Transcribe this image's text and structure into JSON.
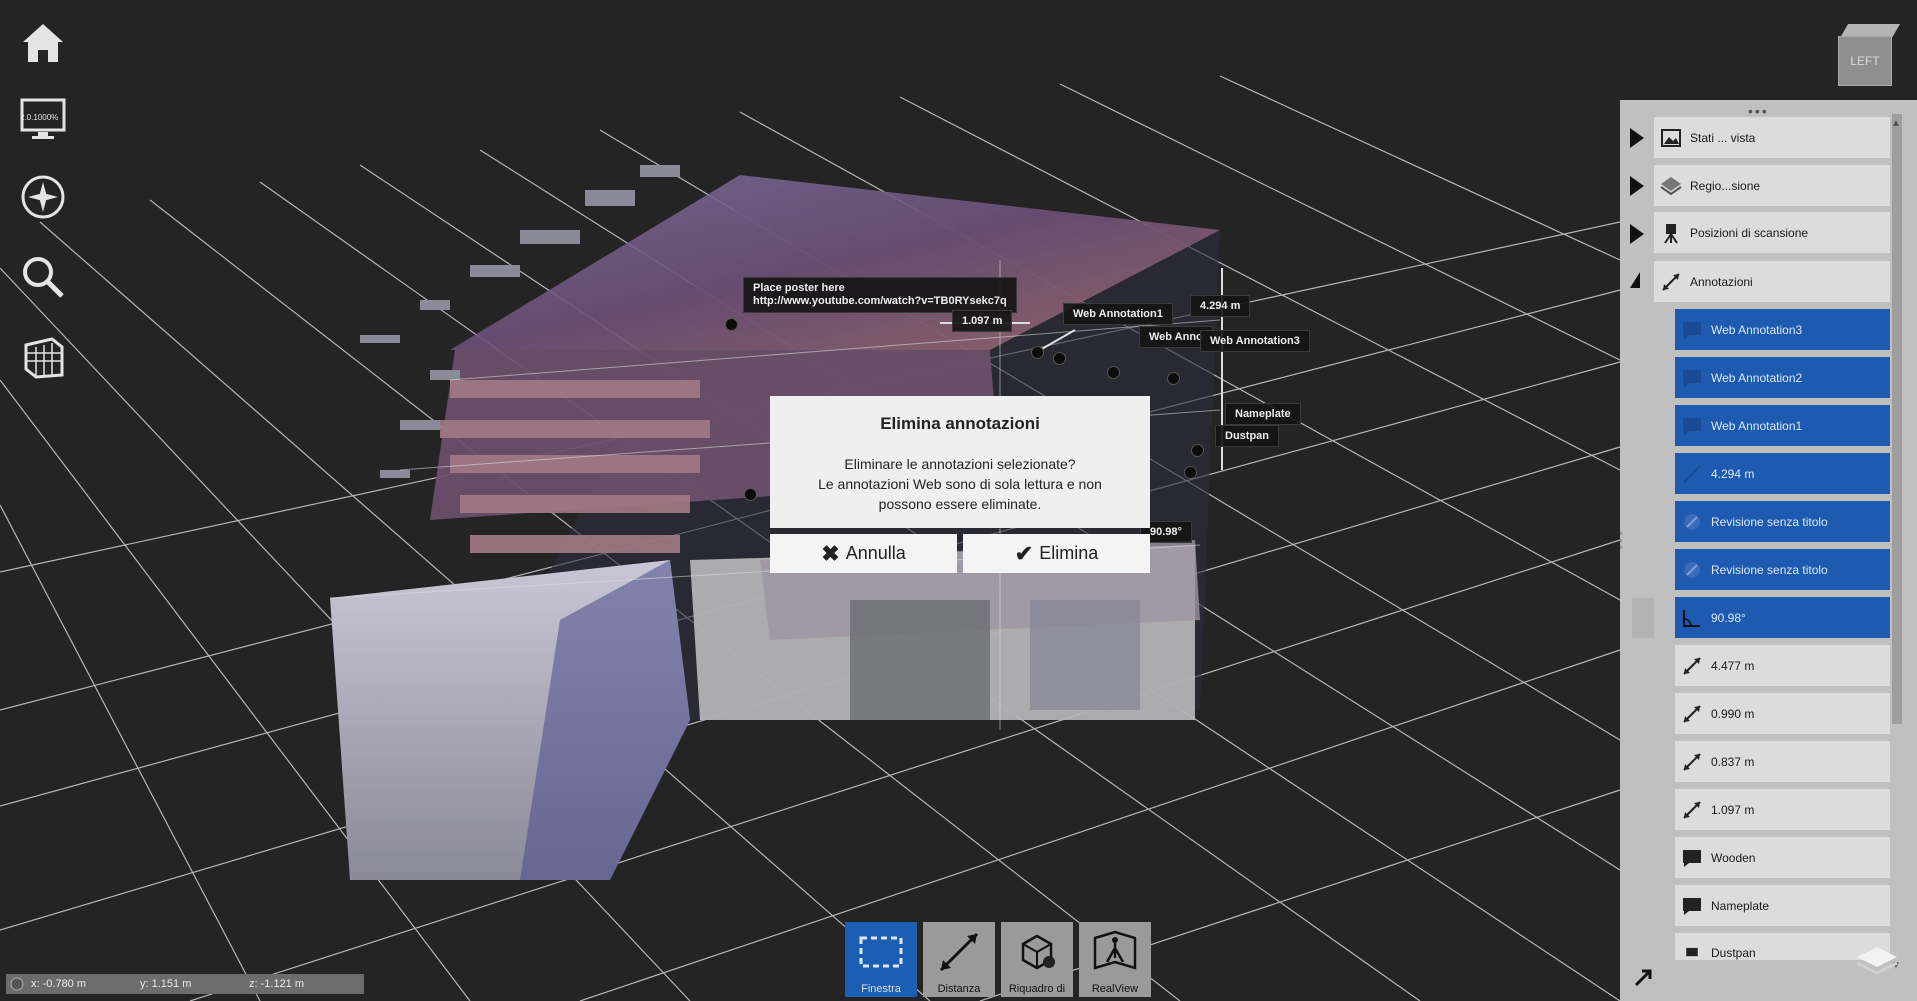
{
  "left_toolbar": [
    {
      "id": "home",
      "icon": "home-icon"
    },
    {
      "id": "display",
      "icon": "monitor-icon",
      "caption": "2.0.1000%"
    },
    {
      "id": "navigation",
      "icon": "compass-icon"
    },
    {
      "id": "zoom",
      "icon": "magnifier-icon"
    },
    {
      "id": "clip",
      "icon": "clipping-box-icon"
    }
  ],
  "viewcube": {
    "face_label": "LEFT"
  },
  "scene_labels": {
    "poster_line1": "Place poster here",
    "poster_line2": "http://www.youtube.com/watch?v=TB0RYsekc7q",
    "dist_1097": "1.097 m",
    "web1": "Web Annotation1",
    "dist_4294": "4.294 m",
    "web2": "Web Anno",
    "web3": "Web Annotation3",
    "nameplate": "Nameplate",
    "dustpan": "Dustpan",
    "angle": "90.98°"
  },
  "dialog": {
    "title": "Elimina annotazioni",
    "message_line1": "Eliminare le annotazioni selezionate?",
    "message_line2": "Le annotazioni Web sono di sola lettura e non",
    "message_line3": "possono essere eliminate.",
    "cancel_label": "Annulla",
    "confirm_label": "Elimina"
  },
  "bottom_toolbar": {
    "finestra": "Finestra",
    "distanza": "Distanza",
    "riquadro": "Riquadro di",
    "realview": "RealView"
  },
  "statusbar": {
    "x": "x:  -0.780 m",
    "y": "y:  1.151 m",
    "z": "z:  -1.121 m"
  },
  "tree": {
    "groups": [
      {
        "label": "Stati ... vista",
        "icon": "image-icon"
      },
      {
        "label": "Regio...sione",
        "icon": "layers-icon"
      },
      {
        "label": "Posizioni di scansione",
        "icon": "scanner-icon"
      },
      {
        "label": "Annotazioni",
        "icon": "measure-icon"
      }
    ],
    "items": [
      {
        "label": "Web Annotation3",
        "icon": "comment-icon",
        "selected": true
      },
      {
        "label": "Web Annotation2",
        "icon": "comment-icon",
        "selected": true
      },
      {
        "label": "Web Annotation1",
        "icon": "comment-icon",
        "selected": true
      },
      {
        "label": "4.294 m",
        "icon": "measure-icon",
        "selected": true
      },
      {
        "label": "Revisione senza titolo",
        "icon": "markup-icon",
        "selected": true
      },
      {
        "label": "Revisione senza titolo",
        "icon": "markup-icon",
        "selected": true
      },
      {
        "label": "90.98°",
        "icon": "angle-icon",
        "selected": true
      },
      {
        "label": "4.477 m",
        "icon": "measure-icon",
        "selected": false
      },
      {
        "label": "0.990 m",
        "icon": "measure-icon",
        "selected": false
      },
      {
        "label": "0.837 m",
        "icon": "measure-icon",
        "selected": false
      },
      {
        "label": "1.097 m",
        "icon": "measure-icon",
        "selected": false
      },
      {
        "label": "Wooden",
        "icon": "comment-icon",
        "selected": false
      },
      {
        "label": "Nameplate",
        "icon": "comment-icon",
        "selected": false
      },
      {
        "label": "Dustpan",
        "icon": "comment-icon",
        "selected": false
      }
    ]
  },
  "colors": {
    "selection": "#1d5ab0",
    "panel": "#c0c0c0",
    "background": "#242424"
  }
}
